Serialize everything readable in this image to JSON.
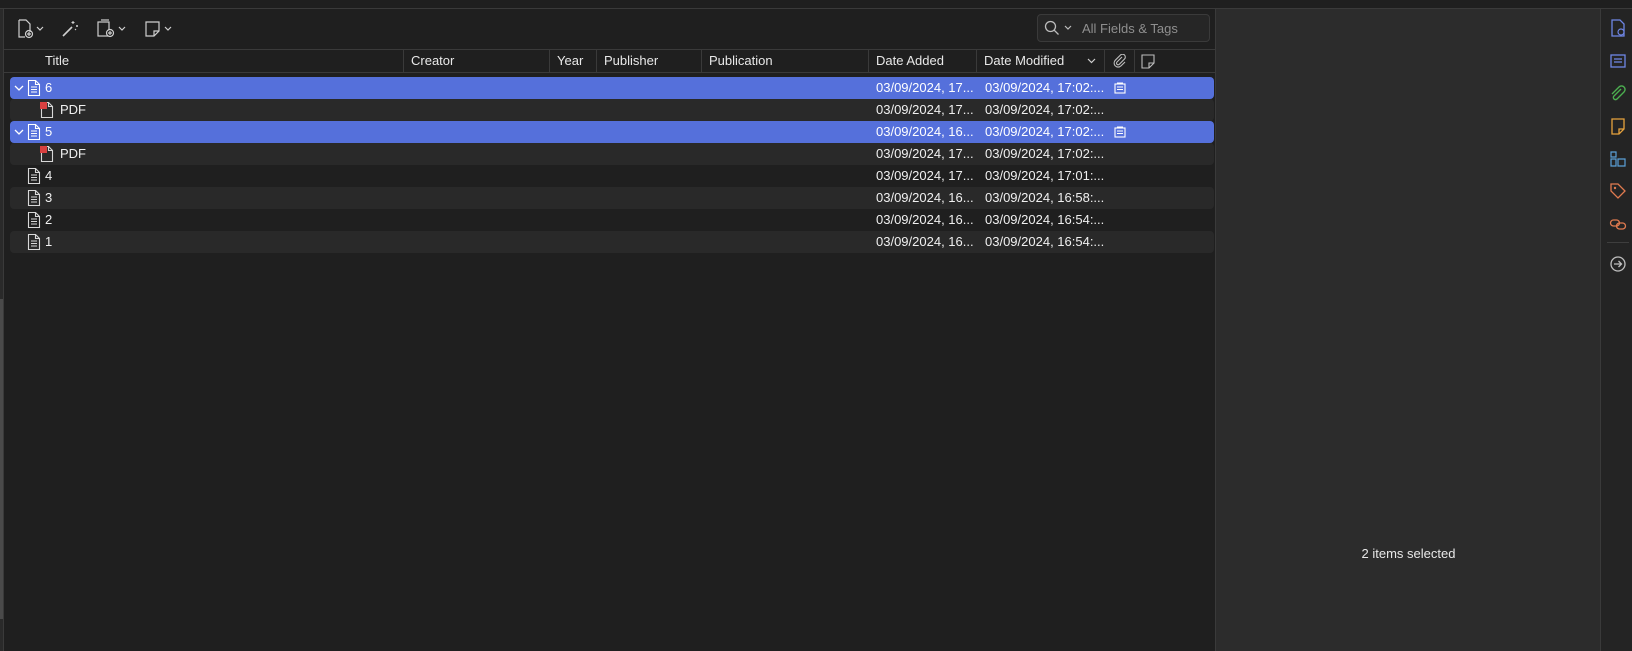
{
  "toolbar": {
    "new_item_icon": "new-item-icon",
    "magic_wand_icon": "add-by-identifier-icon",
    "add_attachment_icon": "add-attachment-icon",
    "new_note_icon": "new-note-icon",
    "search_placeholder": "All Fields & Tags"
  },
  "columns": {
    "title": "Title",
    "creator": "Creator",
    "year": "Year",
    "publisher": "Publisher",
    "publication": "Publication",
    "date_added": "Date Added",
    "date_modified": "Date Modified"
  },
  "rows": [
    {
      "title": "6",
      "type": "item",
      "expanded": true,
      "selected": true,
      "date_added": "03/09/2024, 17...",
      "date_modified": "03/09/2024, 17:02:...",
      "has_note": true
    },
    {
      "title": "PDF",
      "type": "pdf",
      "selected": false,
      "date_added": "03/09/2024, 17...",
      "date_modified": "03/09/2024, 17:02:..."
    },
    {
      "title": "5",
      "type": "item",
      "expanded": true,
      "selected": true,
      "date_added": "03/09/2024, 16...",
      "date_modified": "03/09/2024, 17:02:...",
      "has_note": true
    },
    {
      "title": "PDF",
      "type": "pdf",
      "selected": false,
      "date_added": "03/09/2024, 17...",
      "date_modified": "03/09/2024, 17:02:..."
    },
    {
      "title": "4",
      "type": "item",
      "selected": false,
      "date_added": "03/09/2024, 17...",
      "date_modified": "03/09/2024, 17:01:..."
    },
    {
      "title": "3",
      "type": "item",
      "selected": false,
      "date_added": "03/09/2024, 16...",
      "date_modified": "03/09/2024, 16:58:..."
    },
    {
      "title": "2",
      "type": "item",
      "selected": false,
      "date_added": "03/09/2024, 16...",
      "date_modified": "03/09/2024, 16:54:..."
    },
    {
      "title": "1",
      "type": "item",
      "selected": false,
      "date_added": "03/09/2024, 16...",
      "date_modified": "03/09/2024, 16:54:..."
    }
  ],
  "info_pane": {
    "status_text": "2 items selected"
  },
  "side_nav": [
    {
      "icon": "info-icon",
      "color": "#6f86e6"
    },
    {
      "icon": "abstract-icon",
      "color": "#6f86e6"
    },
    {
      "icon": "attachments-icon",
      "color": "#4caf50"
    },
    {
      "icon": "notes-icon",
      "color": "#e6a23c"
    },
    {
      "icon": "libraries-collections-icon",
      "color": "#5aa0d8"
    },
    {
      "icon": "tags-icon",
      "color": "#e07a4f"
    },
    {
      "icon": "related-icon",
      "color": "#e07a4f"
    },
    {
      "icon": "locate-icon",
      "color": "#bfbfbf"
    }
  ],
  "colors": {
    "selection": "#5570db",
    "background": "#1f1f1f",
    "alt_row": "#292929",
    "pdf_red": "#d94040"
  }
}
